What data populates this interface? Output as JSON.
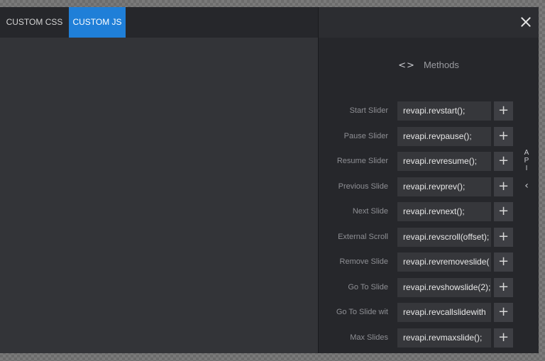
{
  "tabs": [
    {
      "label": "CUSTOM CSS"
    },
    {
      "label": "CUSTOM JS"
    }
  ],
  "panel": {
    "heading": "Methods",
    "heading_icon": "<>",
    "side_tab_letters": [
      "A",
      "P",
      "I"
    ],
    "side_tab_chevron": "‹",
    "close_icon": "×"
  },
  "methods": [
    {
      "label": "Start Slider",
      "code": "revapi.revstart();"
    },
    {
      "label": "Pause Slider",
      "code": "revapi.revpause();"
    },
    {
      "label": "Resume Slider",
      "code": "revapi.revresume();"
    },
    {
      "label": "Previous Slide",
      "code": "revapi.revprev();"
    },
    {
      "label": "Next Slide",
      "code": "revapi.revnext();"
    },
    {
      "label": "External Scroll",
      "code": "revapi.revscroll(offset);"
    },
    {
      "label": "Remove Slide",
      "code": "revapi.revremoveslide("
    },
    {
      "label": "Go To Slide",
      "code": "revapi.revshowslide(2);"
    },
    {
      "label": "Go To Slide wit",
      "code": "revapi.revcallslidewith"
    },
    {
      "label": "Max Slides",
      "code": "revapi.revmaxslide();"
    }
  ],
  "add_label": "+",
  "colors": {
    "accent": "#1f7fd8",
    "panel_bg": "#26272b",
    "editor_bg": "#333438"
  }
}
